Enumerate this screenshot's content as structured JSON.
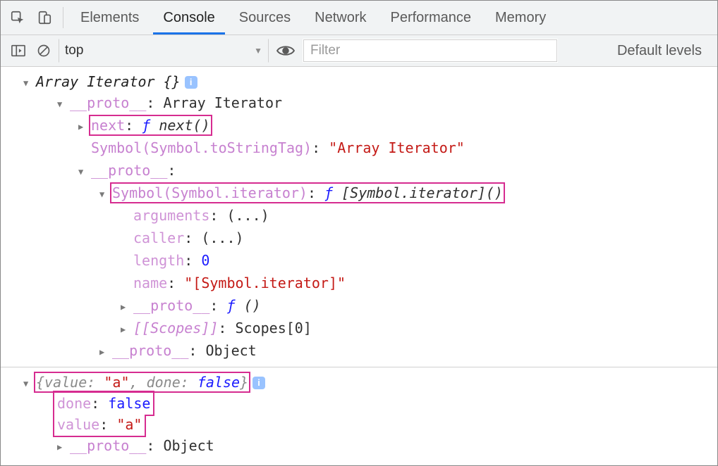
{
  "tabs": {
    "items": [
      "Elements",
      "Console",
      "Sources",
      "Network",
      "Performance",
      "Memory"
    ],
    "active_index": 1
  },
  "toolbar": {
    "context": "top",
    "filter_placeholder": "Filter",
    "levels_label": "Default levels"
  },
  "console": {
    "block1": {
      "header_type": "Array Iterator",
      "header_braces": "{}",
      "proto1_key": "__proto__",
      "proto1_val": "Array Iterator",
      "next_key": "next",
      "next_f": "ƒ",
      "next_fn": "next()",
      "tostringtag_key": "Symbol(Symbol.toStringTag)",
      "tostringtag_val": "\"Array Iterator\"",
      "proto2_key": "__proto__",
      "symiter_key": "Symbol(Symbol.iterator)",
      "symiter_f": "ƒ",
      "symiter_fn": "[Symbol.iterator]()",
      "arguments_key": "arguments",
      "arguments_val": "(...)",
      "caller_key": "caller",
      "caller_val": "(...)",
      "length_key": "length",
      "length_val": "0",
      "name_key": "name",
      "name_val": "\"[Symbol.iterator]\"",
      "proto3_key": "__proto__",
      "proto3_f": "ƒ",
      "proto3_fn": "()",
      "scopes_key": "[[Scopes]]",
      "scopes_val": "Scopes[0]",
      "proto4_key": "__proto__",
      "proto4_val": "Object"
    },
    "block2": {
      "summary_value_key": "value",
      "summary_value_val": "\"a\"",
      "summary_done_key": "done",
      "summary_done_val": "false",
      "done_key": "done",
      "done_val": "false",
      "value_key": "value",
      "value_val": "\"a\"",
      "proto_key": "__proto__",
      "proto_val": "Object"
    }
  }
}
